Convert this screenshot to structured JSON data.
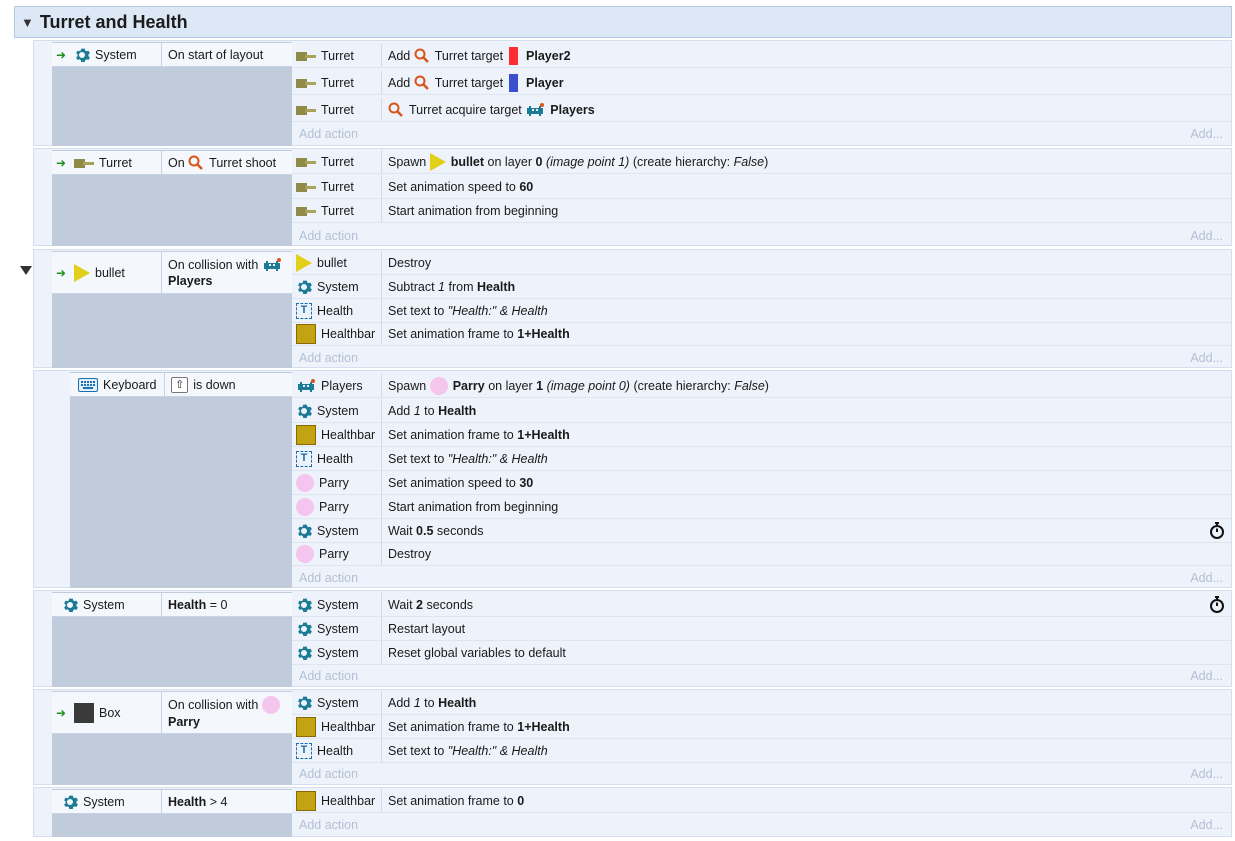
{
  "group": {
    "title": "Turret and Health"
  },
  "labels": {
    "add_action": "Add action",
    "add": "Add..."
  },
  "events": [
    {
      "cond": {
        "object": "System",
        "text": "On start of layout"
      },
      "actions": [
        {
          "object": "Turret",
          "parts": [
            "Add",
            "Turret target",
            "Player2"
          ],
          "swatch": "#ff2e2e"
        },
        {
          "object": "Turret",
          "parts": [
            "Add",
            "Turret target",
            "Player"
          ],
          "swatch": "#3d4fd1"
        },
        {
          "object": "Turret",
          "parts": [
            "Turret acquire target",
            "Players"
          ]
        }
      ]
    },
    {
      "cond": {
        "object": "Turret",
        "pre": "On",
        "text": "Turret shoot"
      },
      "actions": [
        {
          "object": "Turret",
          "parts": [
            "Spawn",
            "bullet",
            "on layer",
            "0",
            "(image point 1)",
            "(create hierarchy:",
            "False",
            ")"
          ]
        },
        {
          "object": "Turret",
          "parts": [
            "Set animation speed to",
            "60"
          ]
        },
        {
          "object": "Turret",
          "parts": [
            "Start animation from beginning"
          ]
        }
      ]
    },
    {
      "cond": {
        "object": "bullet",
        "text": "On collision with",
        "target": "Players"
      },
      "actions": [
        {
          "object": "bullet",
          "parts": [
            "Destroy"
          ]
        },
        {
          "object": "System",
          "parts": [
            "Subtract",
            "1",
            "from",
            "Health"
          ]
        },
        {
          "object": "Health",
          "parts": [
            "Set text to",
            "\"Health:\" & Health"
          ]
        },
        {
          "object": "Healthbar",
          "parts": [
            "Set animation frame to",
            "1+Health"
          ]
        }
      ]
    },
    {
      "cond": {
        "object": "Keyboard",
        "key": "⇧",
        "text": "is down"
      },
      "actions": [
        {
          "object": "Players",
          "parts": [
            "Spawn",
            "Parry",
            "on layer",
            "1",
            "(image point 0)",
            "(create hierarchy:",
            "False",
            ")"
          ]
        },
        {
          "object": "System",
          "parts": [
            "Add",
            "1",
            "to",
            "Health"
          ]
        },
        {
          "object": "Healthbar",
          "parts": [
            "Set animation frame to",
            "1+Health"
          ]
        },
        {
          "object": "Health",
          "parts": [
            "Set text to",
            "\"Health:\" & Health"
          ]
        },
        {
          "object": "Parry",
          "parts": [
            "Set animation speed to",
            "30"
          ]
        },
        {
          "object": "Parry",
          "parts": [
            "Start animation from beginning"
          ]
        },
        {
          "object": "System",
          "parts": [
            "Wait",
            "0.5",
            "seconds"
          ]
        },
        {
          "object": "Parry",
          "parts": [
            "Destroy"
          ]
        }
      ]
    },
    {
      "cond": {
        "object": "System",
        "text_b": "Health",
        "text": "= 0"
      },
      "actions": [
        {
          "object": "System",
          "parts": [
            "Wait",
            "2",
            "seconds"
          ]
        },
        {
          "object": "System",
          "parts": [
            "Restart layout"
          ]
        },
        {
          "object": "System",
          "parts": [
            "Reset global variables to default"
          ]
        }
      ]
    },
    {
      "cond": {
        "object": "Box",
        "text": "On collision with",
        "target": "Parry"
      },
      "actions": [
        {
          "object": "System",
          "parts": [
            "Add",
            "1",
            "to",
            "Health"
          ]
        },
        {
          "object": "Healthbar",
          "parts": [
            "Set animation frame to",
            "1+Health"
          ]
        },
        {
          "object": "Health",
          "parts": [
            "Set text to",
            "\"Health:\" & Health"
          ]
        }
      ]
    },
    {
      "cond": {
        "object": "System",
        "text_b": "Health",
        "text": "> 4"
      },
      "actions": [
        {
          "object": "Healthbar",
          "parts": [
            "Set animation frame to",
            "0"
          ]
        }
      ]
    }
  ],
  "colors": {
    "system_gear": "#1b7a94",
    "turret_target": "#d9541a",
    "trigger_arrow": "#1f8f1f"
  },
  "icons": {
    "system": "gear-icon",
    "turret": "turret-icon",
    "bullet": "bullet-triangle-icon",
    "parry": "parry-circle-icon",
    "healthbar": "healthbar-icon",
    "health": "text-object-icon",
    "players": "players-invader-icon",
    "keyboard": "keyboard-icon",
    "box": "box-icon",
    "timer": "stopwatch-icon",
    "turret_behavior": "turret-behavior-icon"
  }
}
